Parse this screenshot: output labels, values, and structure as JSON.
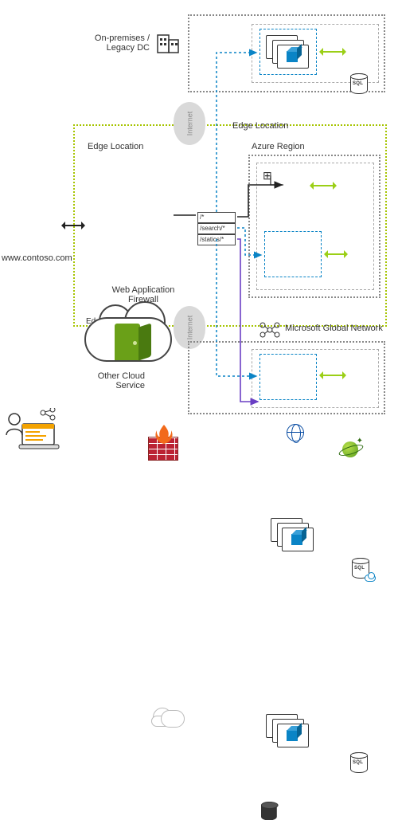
{
  "client": {
    "url": "www.contoso.com"
  },
  "on_prem": {
    "label": "On-premises /\nLegacy DC"
  },
  "edge": {
    "label_top": "Edge Location",
    "label_inner": "Edge Location",
    "label_bottom": "Edge Location",
    "waf_label": "Web Application\nFirewall"
  },
  "azure_region": {
    "label": "Azure Region"
  },
  "routes": {
    "default": "/*",
    "search": "/search/*",
    "statics": "/statics/*"
  },
  "msft_net": {
    "label": "Microsoft Global Network"
  },
  "other_cloud": {
    "label": "Other Cloud\nService"
  },
  "internet": {
    "label": "Internet"
  },
  "sql": {
    "tag": "SQL"
  }
}
